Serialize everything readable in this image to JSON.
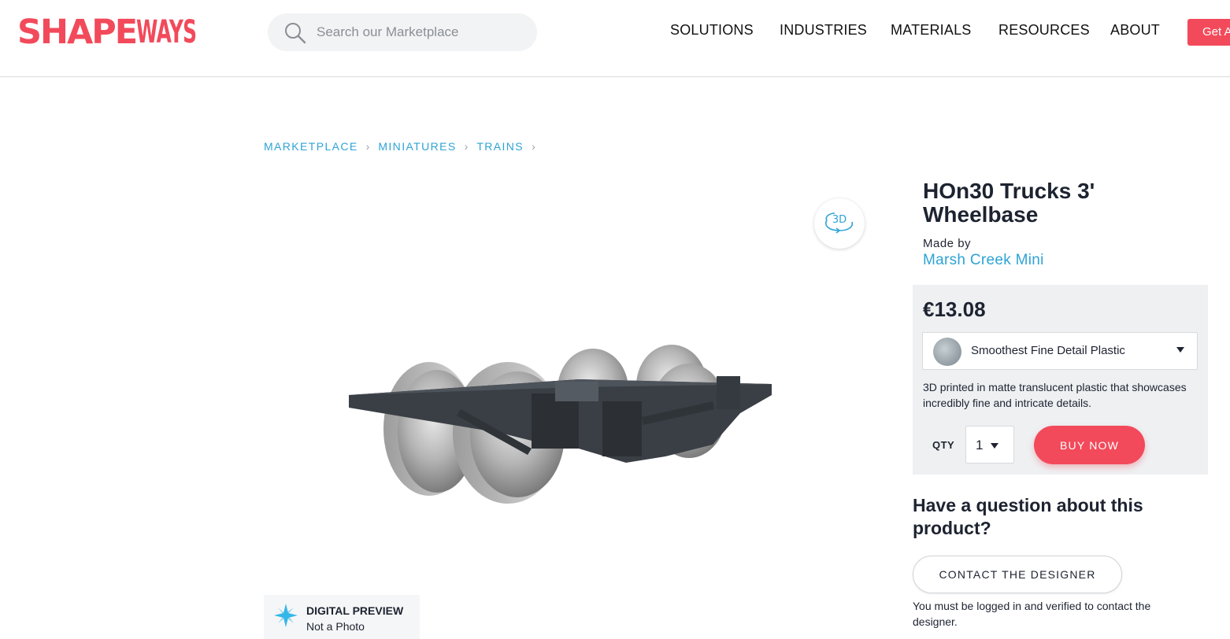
{
  "header": {
    "logo_part1": "SHAPE",
    "logo_part2": "WAYS",
    "search_placeholder": "Search our Marketplace",
    "nav": [
      "SOLUTIONS",
      "INDUSTRIES",
      "MATERIALS",
      "RESOURCES",
      "ABOUT"
    ],
    "cta_label": "Get A"
  },
  "breadcrumb": [
    "MARKETPLACE",
    "MINIATURES",
    "TRAINS"
  ],
  "viewer": {
    "btn_3d_label": "3D",
    "preview_title": "DIGITAL PREVIEW",
    "preview_subtitle": "Not a Photo"
  },
  "product": {
    "title": "HOn30 Trucks 3' Wheelbase",
    "made_by_label": "Made by",
    "designer": "Marsh Creek Mini",
    "price": "€13.08",
    "material": "Smoothest Fine Detail Plastic",
    "material_description": "3D printed in matte translucent plastic that showcases incredibly fine and intricate details.",
    "qty_label": "QTY",
    "qty_value": "1",
    "buy_label": "BUY NOW"
  },
  "contact": {
    "heading": "Have a question about this product?",
    "button_label": "CONTACT THE DESIGNER",
    "note": "You must be logged in and verified to contact the designer."
  },
  "colors": {
    "brand": "#f24a5b",
    "link": "#2ea3d6",
    "text": "#1d2330",
    "panel": "#eef0f2"
  }
}
